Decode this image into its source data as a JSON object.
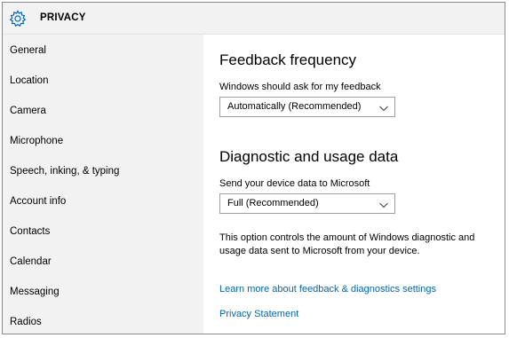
{
  "header": {
    "title": "PRIVACY",
    "icon": "gear-icon",
    "accent": "#0066b4"
  },
  "sidebar": {
    "items": [
      {
        "label": "General"
      },
      {
        "label": "Location"
      },
      {
        "label": "Camera"
      },
      {
        "label": "Microphone"
      },
      {
        "label": "Speech, inking, & typing"
      },
      {
        "label": "Account info"
      },
      {
        "label": "Contacts"
      },
      {
        "label": "Calendar"
      },
      {
        "label": "Messaging"
      },
      {
        "label": "Radios"
      }
    ]
  },
  "main": {
    "feedback": {
      "title": "Feedback frequency",
      "label": "Windows should ask for my feedback",
      "selected": "Automatically (Recommended)"
    },
    "diagnostic": {
      "title": "Diagnostic and usage data",
      "label": "Send your device data to Microsoft",
      "selected": "Full (Recommended)",
      "description": "This option controls the amount of Windows diagnostic and usage data sent to Microsoft from your device."
    },
    "links": {
      "learn_more": "Learn more about feedback & diagnostics settings",
      "privacy": "Privacy Statement"
    }
  }
}
